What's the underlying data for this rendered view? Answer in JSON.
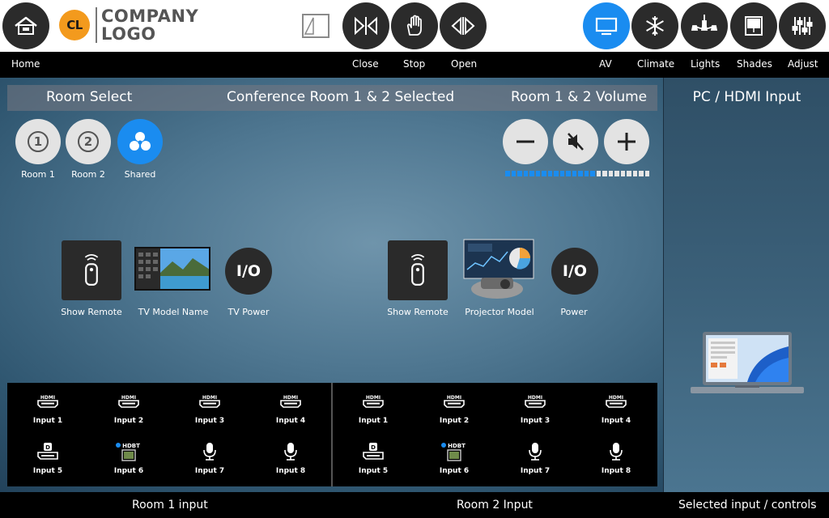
{
  "header": {
    "logo_badge": "CL",
    "logo_line1": "COMPANY",
    "logo_line2": "LOGO",
    "accent_color": "#1a8cf0",
    "icons": [
      "home-icon",
      "door-icon",
      "close-icon",
      "stop-icon",
      "open-icon",
      "tv-icon",
      "snowflake-icon",
      "chandelier-icon",
      "shades-icon",
      "sliders-icon"
    ]
  },
  "nav": {
    "home": "Home",
    "close": "Close",
    "stop": "Stop",
    "open": "Open",
    "av": "AV",
    "climate": "Climate",
    "lights": "Lights",
    "shades": "Shades",
    "adjust": "Adjust",
    "active": "AV"
  },
  "titlebar": {
    "room_select": "Room Select",
    "status": "Conference Room 1 & 2 Selected",
    "volume": "Room 1 & 2 Volume"
  },
  "rooms": [
    {
      "num": "1",
      "label": "Room 1",
      "active": false
    },
    {
      "num": "2",
      "label": "Room 2",
      "active": false
    },
    {
      "label": "Shared",
      "active": true
    }
  ],
  "volume": {
    "level_segments_on": 15,
    "total_segments": 24,
    "on_color": "#1a8cf0",
    "off_color": "#e6e6e6"
  },
  "room1_controls": {
    "remote": "Show Remote",
    "display": "TV Model Name",
    "power": "TV Power",
    "power_glyph": "I/O"
  },
  "room2_controls": {
    "remote": "Show Remote",
    "display": "Projector Model",
    "power": "Power",
    "power_glyph": "I/O"
  },
  "room1_inputs": [
    {
      "label": "Input 1",
      "type": "hdmi"
    },
    {
      "label": "Input 2",
      "type": "hdmi"
    },
    {
      "label": "Input 3",
      "type": "hdmi"
    },
    {
      "label": "Input 4",
      "type": "hdmi"
    },
    {
      "label": "Input 5",
      "type": "displayport"
    },
    {
      "label": "Input 6",
      "type": "hdbt"
    },
    {
      "label": "Input 7",
      "type": "mic"
    },
    {
      "label": "Input 8",
      "type": "mic"
    }
  ],
  "room2_inputs": [
    {
      "label": "Input 1",
      "type": "hdmi"
    },
    {
      "label": "Input 2",
      "type": "hdmi"
    },
    {
      "label": "Input 3",
      "type": "hdmi"
    },
    {
      "label": "Input 4",
      "type": "hdmi"
    },
    {
      "label": "Input 5",
      "type": "displayport"
    },
    {
      "label": "Input 6",
      "type": "hdbt"
    },
    {
      "label": "Input 7",
      "type": "mic"
    },
    {
      "label": "Input 8",
      "type": "mic"
    }
  ],
  "right_panel": {
    "title": "PC / HDMI Input"
  },
  "footer": {
    "room1": "Room 1 input",
    "room2": "Room 2 Input",
    "selected": "Selected input / controls"
  }
}
